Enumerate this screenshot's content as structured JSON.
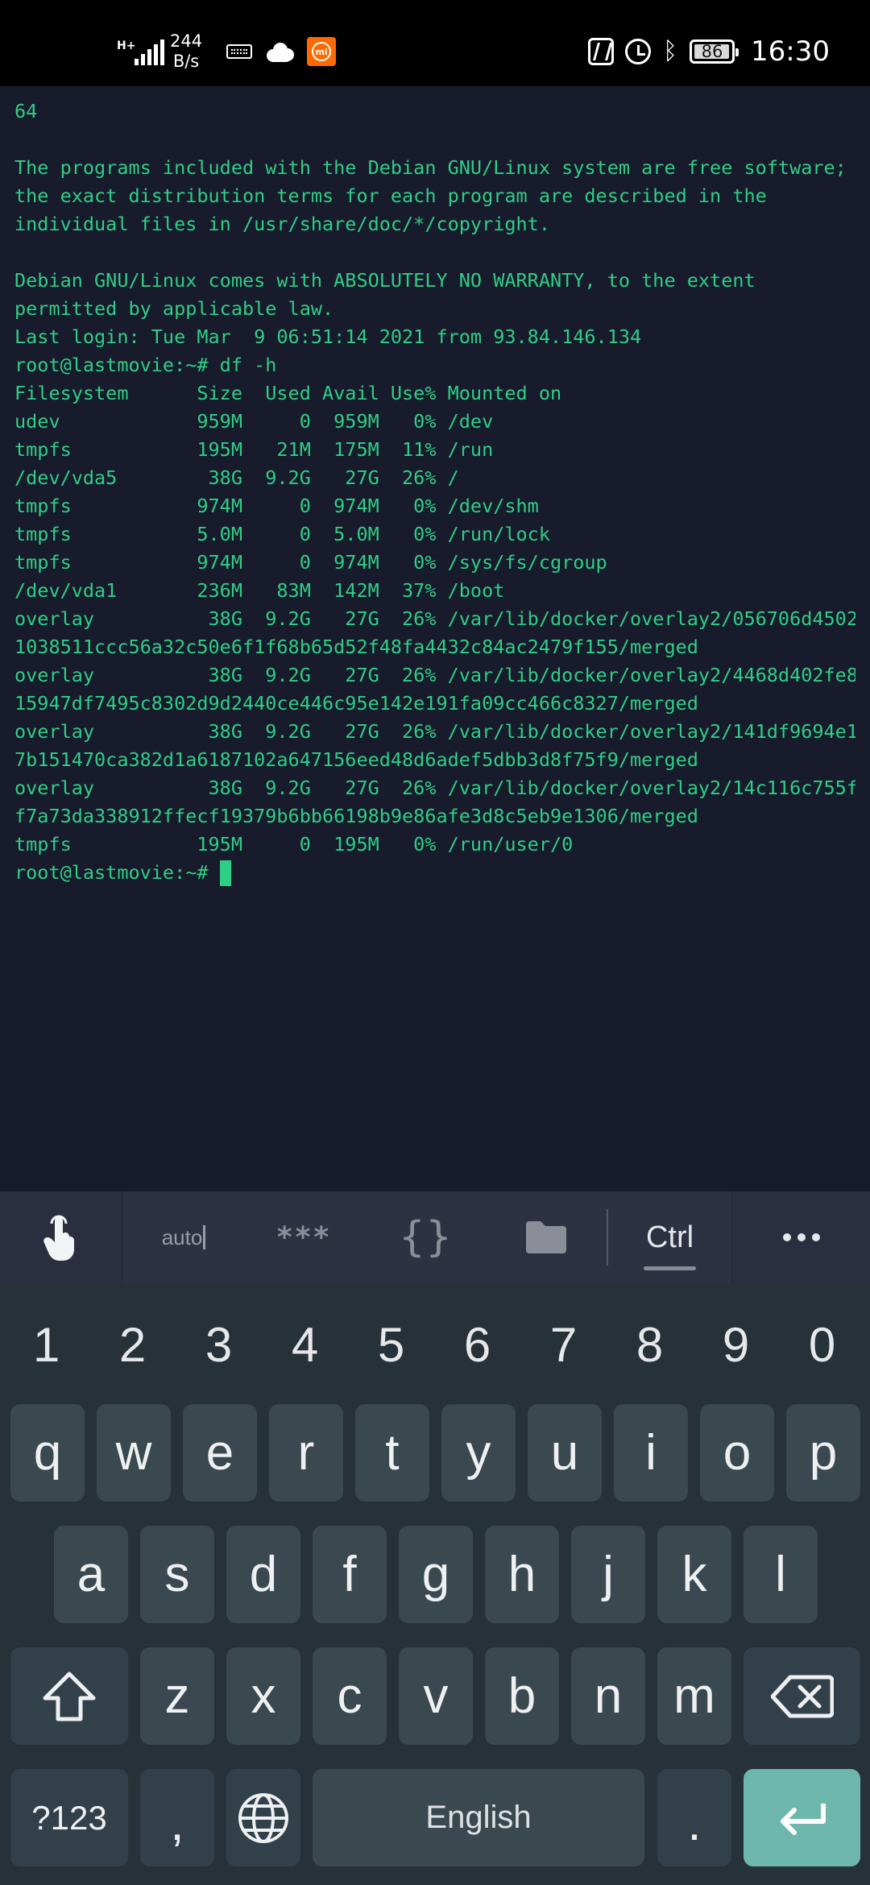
{
  "status_bar": {
    "network_type": "H+",
    "speed_value": "244",
    "speed_unit": "B/s",
    "battery": "86",
    "time": "16:30",
    "icons": [
      "signal-icon",
      "keyboard-icon",
      "cloud-icon",
      "mi-icon",
      "nfc-icon",
      "alarm-icon",
      "bluetooth-icon",
      "battery-icon"
    ]
  },
  "terminal": {
    "lines": [
      "64",
      "",
      "The programs included with the Debian GNU/Linux system are free software;",
      "the exact distribution terms for each program are described in the",
      "individual files in /usr/share/doc/*/copyright.",
      "",
      "Debian GNU/Linux comes with ABSOLUTELY NO WARRANTY, to the extent",
      "permitted by applicable law.",
      "Last login: Tue Mar  9 06:51:14 2021 from 93.84.146.134",
      "root@lastmovie:~# df -h",
      "Filesystem      Size  Used Avail Use% Mounted on",
      "udev            959M     0  959M   0% /dev",
      "tmpfs           195M   21M  175M  11% /run",
      "/dev/vda5        38G  9.2G   27G  26% /",
      "tmpfs           974M     0  974M   0% /dev/shm",
      "tmpfs           5.0M     0  5.0M   0% /run/lock",
      "tmpfs           974M     0  974M   0% /sys/fs/cgroup",
      "/dev/vda1       236M   83M  142M  37% /boot",
      "overlay          38G  9.2G   27G  26% /var/lib/docker/overlay2/056706d4502",
      "1038511ccc56a32c50e6f1f68b65d52f48fa4432c84ac2479f155/merged",
      "overlay          38G  9.2G   27G  26% /var/lib/docker/overlay2/4468d402fe8",
      "15947df7495c8302d9d2440ce446c95e142e191fa09cc466c8327/merged",
      "overlay          38G  9.2G   27G  26% /var/lib/docker/overlay2/141df9694e1",
      "7b151470ca382d1a6187102a647156eed48d6adef5dbb3d8f75f9/merged",
      "overlay          38G  9.2G   27G  26% /var/lib/docker/overlay2/14c116c755f",
      "f7a73da338912ffecf19379b6bb66198b9e86afe3d8c5eb9e1306/merged",
      "tmpfs           195M     0  195M   0% /run/user/0"
    ],
    "prompt": "root@lastmovie:~#",
    "text_color": "#2fce86",
    "background": "#171b2b"
  },
  "extra_keys": {
    "auto_label": "auto",
    "password_label": "***",
    "braces_label": "{}",
    "ctrl_label": "Ctrl",
    "icons": [
      "touch-icon",
      "folder-icon",
      "more-icon"
    ]
  },
  "keyboard": {
    "numbers": [
      "1",
      "2",
      "3",
      "4",
      "5",
      "6",
      "7",
      "8",
      "9",
      "0"
    ],
    "row1": [
      "q",
      "w",
      "e",
      "r",
      "t",
      "y",
      "u",
      "i",
      "o",
      "p"
    ],
    "row2": [
      "a",
      "s",
      "d",
      "f",
      "g",
      "h",
      "j",
      "k",
      "l"
    ],
    "row3": [
      "z",
      "x",
      "c",
      "v",
      "b",
      "n",
      "m"
    ],
    "symbols_label": "?123",
    "comma_label": ",",
    "space_label": "English",
    "period_label": ".",
    "enter_color": "#6eb7ac",
    "key_color": "#3a484f"
  }
}
